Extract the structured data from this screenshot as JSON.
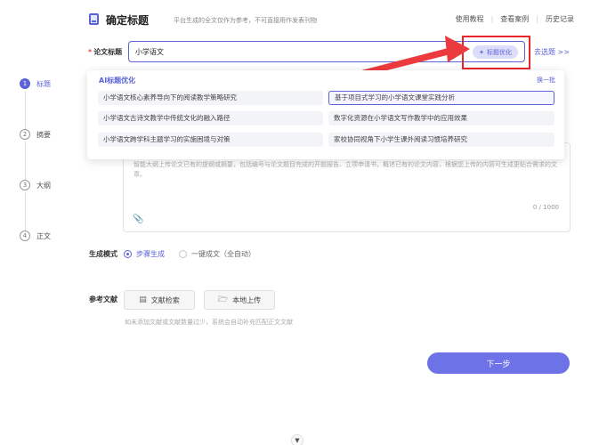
{
  "header": {
    "title": "确定标题",
    "subtitle": "平台生成的全文仅作为参考，不可直接用作发表刊物",
    "links": [
      "使用教程",
      "查看案例",
      "历史记录"
    ]
  },
  "steps": [
    {
      "num": "1",
      "label": "标题"
    },
    {
      "num": "2",
      "label": "摘要"
    },
    {
      "num": "3",
      "label": "大纲"
    },
    {
      "num": "4",
      "label": "正文"
    }
  ],
  "title_field": {
    "required_mark": "*",
    "label": "论文标题",
    "value": "小学语文",
    "optimize_label": "标题优化",
    "goto_label": "去选题 >>"
  },
  "ai_panel": {
    "title": "AI标题优化",
    "refresh": "换一批",
    "suggestions": [
      "小学语文核心素养导向下的阅读教学策略研究",
      "基于项目式学习的小学语文课堂实践分析",
      "小学语文古诗文教学中传统文化的融入路径",
      "数字化资源在小学语文写作教学中的应用效果",
      "小学语文跨学科主题学习的实施困境与对策",
      "家校协同视角下小学生课外阅读习惯培养研究"
    ]
  },
  "abstract": {
    "hint": "智能大纲上传论文已有的提纲或摘要，包括编号与论文题目完成的开题报告、立项申请书，概述已有的论文内容，根据您上传的内容可生成更贴合需求的文章。",
    "counter": "0 / 1000"
  },
  "mode": {
    "label": "生成模式",
    "options": [
      "步骤生成",
      "一键成文（全自动）"
    ]
  },
  "reference": {
    "label": "参考文献",
    "search_btn": "文献检索",
    "upload_btn": "本地上传",
    "note": "如未添加文献或文献数量过少，系统会自动补充匹配正文文献"
  },
  "next_btn": "下一步",
  "colors": {
    "accent": "#5b63d6",
    "next_button": "#6d72e6",
    "highlight": "#e8272c"
  }
}
